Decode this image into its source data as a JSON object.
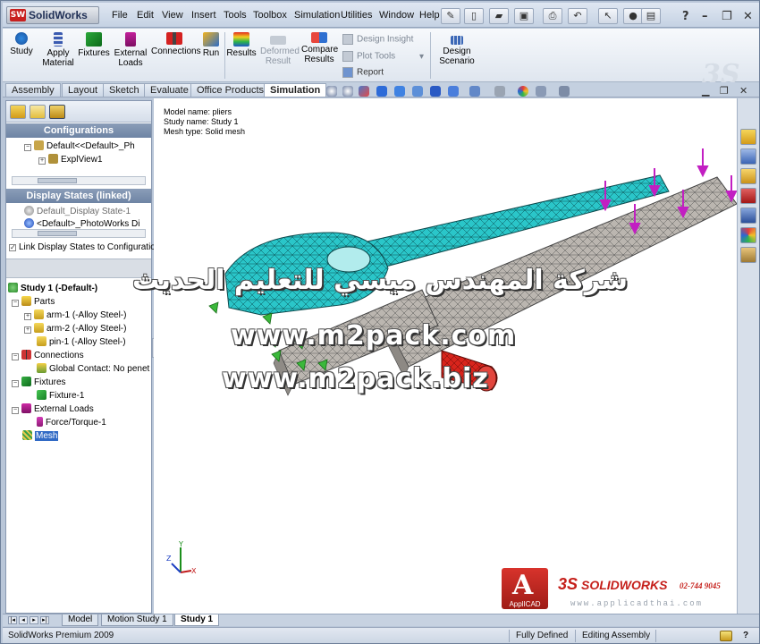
{
  "app": {
    "logo_text": "SolidWorks",
    "logo_badge": "SW"
  },
  "menu": [
    "File",
    "Edit",
    "View",
    "Insert",
    "Tools",
    "Toolbox",
    "Simulation",
    "Utilities",
    "Window",
    "Help"
  ],
  "commands": {
    "study": "Study",
    "apply_material_1": "Apply",
    "apply_material_2": "Material",
    "fixtures": "Fixtures",
    "external_loads_1": "External",
    "external_loads_2": "Loads",
    "connections": "Connections",
    "run": "Run",
    "results": "Results",
    "deformed_1": "Deformed",
    "deformed_2": "Result",
    "compare_1": "Compare",
    "compare_2": "Results",
    "design_insight": "Design Insight",
    "plot_tools": "Plot Tools",
    "report": "Report",
    "design_scenario_1": "Design",
    "design_scenario_2": "Scenario"
  },
  "tabs": [
    "Assembly",
    "Layout",
    "Sketch",
    "Evaluate",
    "Office Products",
    "Simulation"
  ],
  "config_pane": {
    "header": "Configurations",
    "default_config": "Default<<Default>_Ph",
    "explview": "ExplView1",
    "display_header": "Display States (linked)",
    "display_state_1": "Default_Display State-1",
    "display_state_2": "<Default>_PhotoWorks Di",
    "link_checkbox": "Link Display States to Configuratio"
  },
  "study_tree": {
    "study": "Study 1 (-Default-)",
    "parts": "Parts",
    "arm1": "arm-1 (-Alloy Steel-)",
    "arm2": "arm-2 (-Alloy Steel-)",
    "pin1": "pin-1 (-Alloy Steel-)",
    "connections": "Connections",
    "global_contact": "Global Contact: No penet",
    "fixtures": "Fixtures",
    "fixture1": "Fixture-1",
    "external_loads": "External Loads",
    "force": "Force/Torque-1",
    "mesh": "Mesh"
  },
  "model_info": {
    "model_name": "Model name: pliers",
    "study_name": "Study name: Study 1",
    "mesh_type": "Mesh type: Solid mesh"
  },
  "watermark": {
    "arabic": "شركة المهندس ميسي للتعليم الحديث",
    "url1": "www.m2pack.com",
    "url2": "www.m2pack.biz"
  },
  "brand": {
    "box_letter": "A",
    "box_label": "ApplICAD",
    "solidworks": "SOLIDWORKS",
    "ds": "3S",
    "phone": "02-744 9045",
    "url": "www.applicadthai.com"
  },
  "bottom_tabs": [
    "Model",
    "Motion Study 1",
    "Study 1"
  ],
  "status": {
    "app_version": "SolidWorks Premium 2009",
    "defined": "Fully Defined",
    "mode": "Editing Assembly",
    "help": "?"
  },
  "triad": {
    "x": "X",
    "y": "Y",
    "z": "Z"
  },
  "colors": {
    "arm_cyan": "#27c3c6",
    "arm_gray": "#b8b3ad",
    "pin_red": "#d8241c",
    "load_magenta": "#c21fc2",
    "fixture_green": "#3bb83b"
  }
}
